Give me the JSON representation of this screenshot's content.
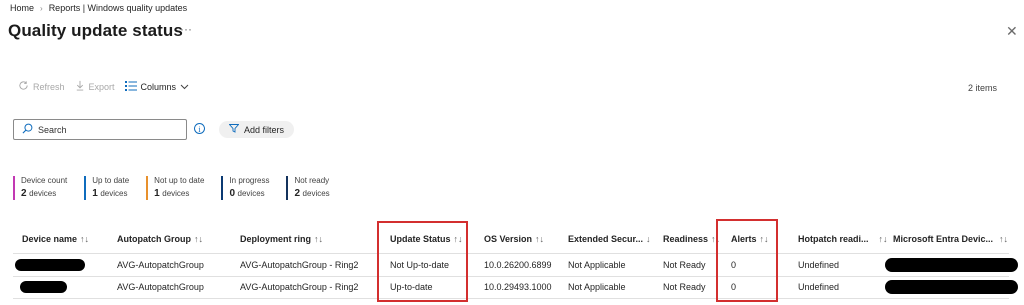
{
  "breadcrumb": {
    "home": "Home",
    "current": "Reports | Windows quality updates",
    "separator": "›"
  },
  "page": {
    "title": "Quality update status",
    "more": "···",
    "close": "✕"
  },
  "toolbar": {
    "refresh": "Refresh",
    "export": "Export",
    "columns": "Columns",
    "items_count": "2 items"
  },
  "search": {
    "placeholder": "Search"
  },
  "filters": {
    "add_label": "Add filters"
  },
  "summary": [
    {
      "label": "Device count",
      "count": "2",
      "unit": "devices",
      "color": "#c239b3"
    },
    {
      "label": "Up to date",
      "count": "1",
      "unit": "devices",
      "color": "#0f6cbd"
    },
    {
      "label": "Not up to date",
      "count": "1",
      "unit": "devices",
      "color": "#e8912d"
    },
    {
      "label": "In progress",
      "count": "0",
      "unit": "devices",
      "color": "#0b3a73"
    },
    {
      "label": "Not ready",
      "count": "2",
      "unit": "devices",
      "color": "#14325c"
    }
  ],
  "table": {
    "sort_glyph": "↑↓",
    "sort_desc_glyph": "↓",
    "columns": [
      "Device name",
      "Autopatch Group",
      "Deployment ring",
      "Update Status",
      "OS Version",
      "Extended Secur...",
      "Readiness",
      "Alerts",
      "Hotpatch readi...",
      "Microsoft Entra Devic..."
    ],
    "rows": [
      [
        "",
        "AVG-AutopatchGroup",
        "AVG-AutopatchGroup - Ring2",
        "Not Up-to-date",
        "10.0.26200.6899",
        "Not Applicable",
        "Not Ready",
        "0",
        "Undefined",
        ""
      ],
      [
        "",
        "AVG-AutopatchGroup",
        "AVG-AutopatchGroup - Ring2",
        "Up-to-date",
        "10.0.29493.1000",
        "Not Applicable",
        "Not Ready",
        "0",
        "Undefined",
        ""
      ]
    ]
  }
}
